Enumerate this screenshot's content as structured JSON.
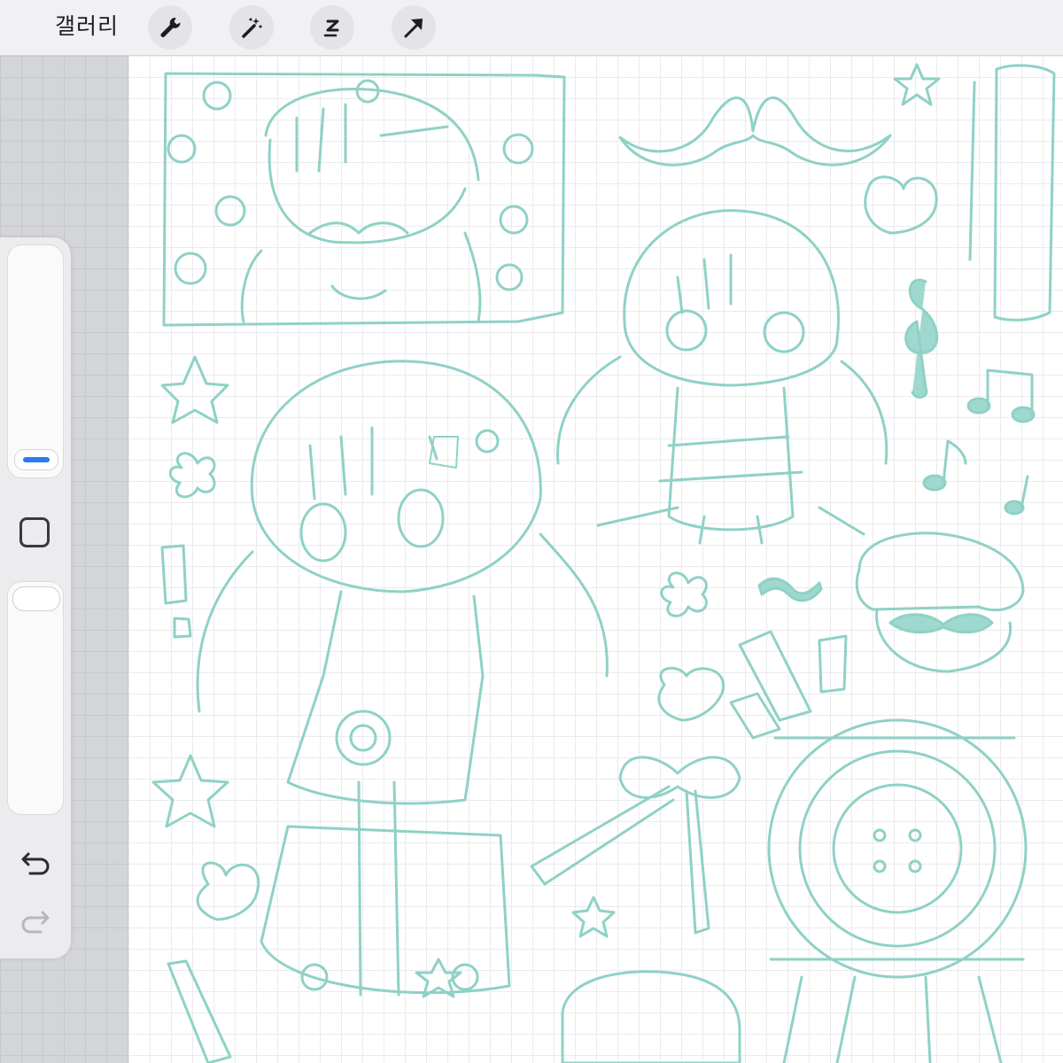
{
  "toolbar": {
    "gallery_label": "갤러리",
    "tools": [
      "wrench-icon",
      "magic-wand-icon",
      "selection-icon",
      "arrow-icon"
    ]
  },
  "sidebar": {
    "controls": [
      "brush-size-slider",
      "modify-button",
      "opacity-slider",
      "undo-icon",
      "redo-icon"
    ]
  },
  "colors": {
    "sketch": "#8fd1c6",
    "accent": "#2a7bf0",
    "toolbar_bg": "#f1f1f3",
    "canvas_bg": "#ffffff"
  }
}
